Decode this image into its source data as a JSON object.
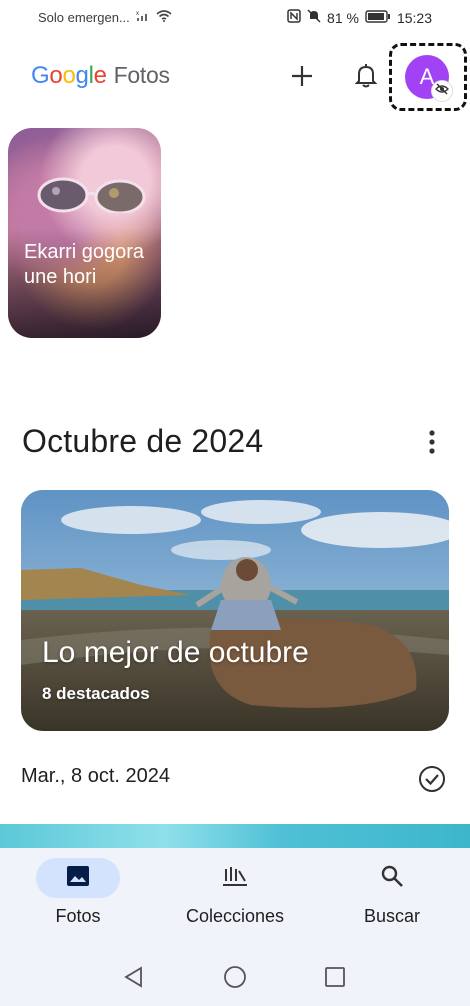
{
  "status_bar": {
    "carrier": "Solo emergen...",
    "battery": "81 %",
    "time": "15:23"
  },
  "header": {
    "logo_parts": [
      "G",
      "o",
      "o",
      "g",
      "l",
      "e"
    ],
    "product": "Fotos",
    "avatar_letter": "A"
  },
  "memory": {
    "title": "Ekarri gogora une hori"
  },
  "section": {
    "title": "Octubre de 2024"
  },
  "highlight": {
    "title": "Lo mejor de octubre",
    "subtitle": "8 destacados"
  },
  "date_row": {
    "label": "Mar., 8 oct. 2024"
  },
  "bottom_nav": {
    "items": [
      {
        "label": "Fotos",
        "icon": "photo-icon"
      },
      {
        "label": "Colecciones",
        "icon": "collections-icon"
      },
      {
        "label": "Buscar",
        "icon": "search-icon"
      }
    ]
  },
  "colors": {
    "accent": "#d3e3fd",
    "avatar": "#a142f4",
    "nav_bg": "#f0f3fa"
  }
}
